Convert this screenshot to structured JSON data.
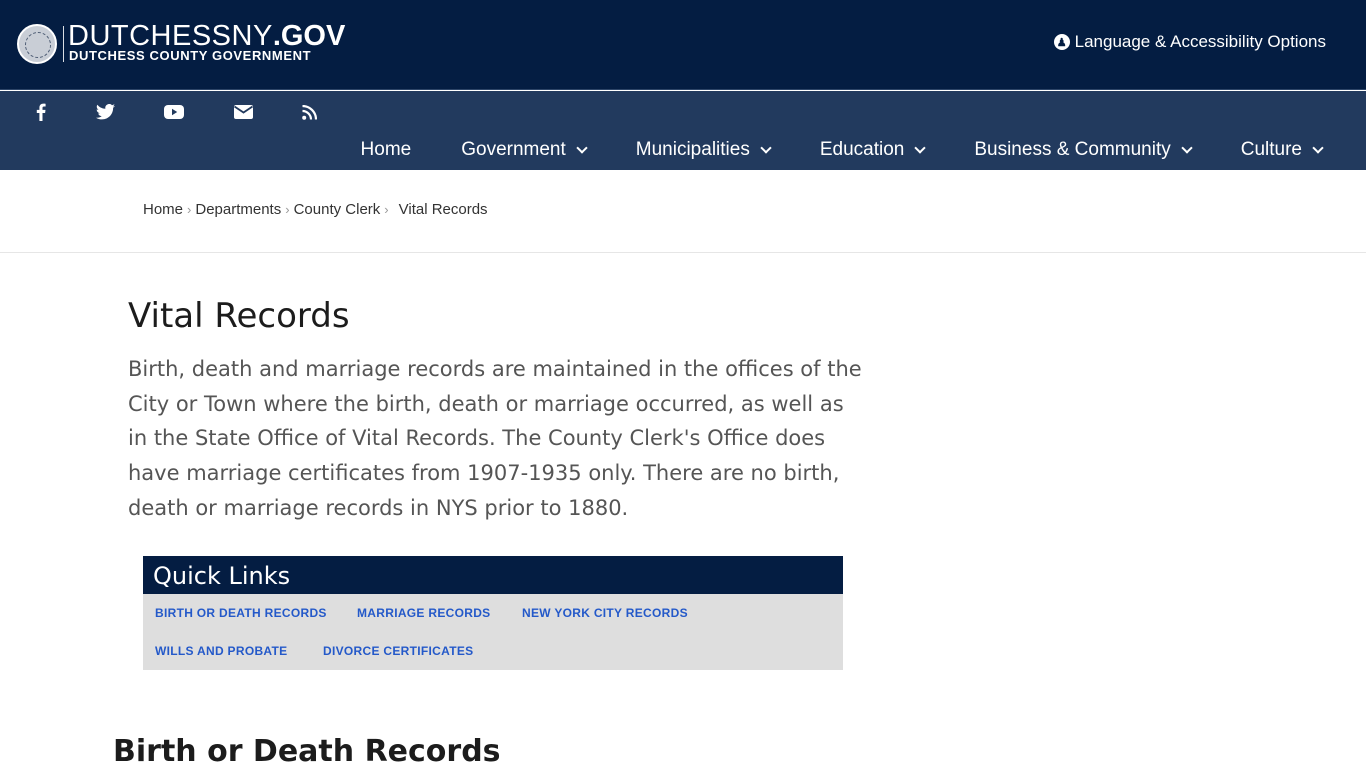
{
  "header": {
    "logo_main_thin": "DUTCHESSNY",
    "logo_main_bold": ".GOV",
    "logo_sub": "DUTCHESS COUNTY GOVERNMENT",
    "lang_label": "Language & Accessibility Options",
    "lang_icon": "accessibility-icon"
  },
  "social": [
    {
      "name": "facebook-icon"
    },
    {
      "name": "twitter-icon"
    },
    {
      "name": "youtube-icon"
    },
    {
      "name": "email-icon"
    },
    {
      "name": "rss-icon"
    }
  ],
  "nav": {
    "items": [
      {
        "label": "Home",
        "dropdown": false
      },
      {
        "label": "Government",
        "dropdown": true
      },
      {
        "label": "Municipalities",
        "dropdown": true
      },
      {
        "label": "Education",
        "dropdown": true
      },
      {
        "label": "Business & Community",
        "dropdown": true
      },
      {
        "label": "Culture",
        "dropdown": true
      }
    ]
  },
  "breadcrumb": {
    "items": [
      "Home",
      "Departments",
      "County Clerk",
      "Vital Records"
    ]
  },
  "main": {
    "title": "Vital Records",
    "intro": "Birth, death and marriage records are maintained in the offices of the City or Town where the birth, death or marriage occurred, as well as in the State Office of Vital Records.  The County Clerk's Office does have marriage certificates from 1907-1935 only.  There are no birth, death or marriage records in NYS prior to 1880.",
    "quick_links": {
      "heading": "Quick Links",
      "links": [
        "BIRTH OR DEATH RECORDS",
        "MARRIAGE RECORDS",
        "NEW YORK CITY RECORDS",
        "WILLS AND PROBATE",
        "DIVORCE CERTIFICATES"
      ]
    },
    "section_title": "Birth or Death Records"
  },
  "colors": {
    "header_bg": "#041d42",
    "nav_bg": "#223a5e",
    "link": "#2459c9",
    "quick_bg": "#dedede"
  }
}
